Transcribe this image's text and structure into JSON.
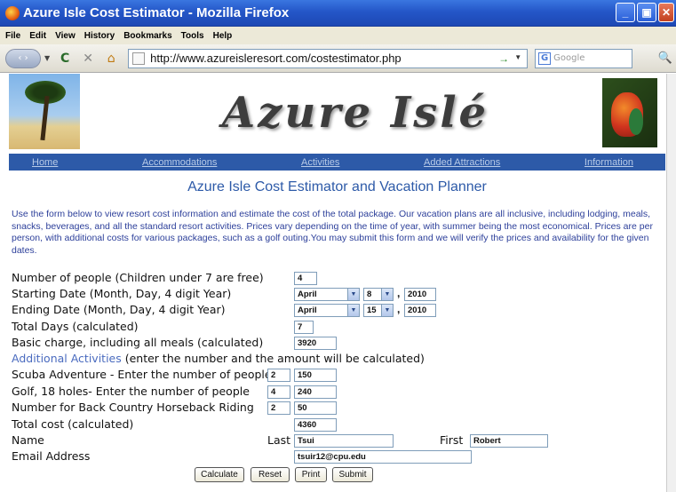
{
  "window": {
    "title": "Azure Isle Cost Estimator - Mozilla Firefox",
    "buttons": [
      "_",
      "▣",
      "✕"
    ]
  },
  "menu": [
    "File",
    "Edit",
    "View",
    "History",
    "Bookmarks",
    "Tools",
    "Help"
  ],
  "toolbar": {
    "url": "http://www.azureisleresort.com/costestimator.php",
    "search_placeholder": "Google",
    "search_engine_label": "G",
    "go_icon": "→",
    "reload_icon": "C",
    "stop_icon": "✕",
    "home_icon": "⌂",
    "back_icons": "‹ ›",
    "dropdown": "▼",
    "search_icon": "🔍"
  },
  "site": {
    "logo_text": "Azure Islé",
    "nav": [
      "Home",
      "Accommodations",
      "Activities",
      "Added Attractions",
      "Information"
    ]
  },
  "form": {
    "title": "Azure Isle Cost Estimator and Vacation Planner",
    "intro": "Use the form below to view resort cost information and estimate the cost of the total package. Our vacation plans are all inclusive, including lodging, meals, snacks, beverages, and all the standard resort activities. Prices vary depending on the time of year, with summer being the most economical. Prices are per person, with additional costs for various packages, such as a golf outing.You may submit this form and we will verify the prices and availability for the given dates.",
    "labels": {
      "people": "Number of people (Children under 7 are free)",
      "start": "Starting Date (Month, Day, 4 digit Year)",
      "end": "Ending Date (Month, Day, 4 digit Year)",
      "days": "Total Days (calculated)",
      "basic": "Basic charge, including all meals (calculated)",
      "additional_link": "Additional Activities",
      "additional_rest": " (enter the number and the amount will be calculated)",
      "scuba": "Scuba Adventure - Enter the number of people",
      "golf": "Golf, 18 holes- Enter the number of people",
      "horse": "Number for Back Country Horseback Riding",
      "total": "Total cost (calculated)",
      "name": "Name",
      "last": "Last",
      "first": "First",
      "email": "Email Address"
    },
    "values": {
      "people": "4",
      "start_month": "April",
      "start_day": "8",
      "start_year": "2010",
      "end_month": "April",
      "end_day": "15",
      "end_year": "2010",
      "days": "7",
      "basic": "3920",
      "scuba_people": "2",
      "scuba_amount": "150",
      "golf_people": "4",
      "golf_amount": "240",
      "horse_people": "2",
      "horse_amount": "50",
      "total": "4360",
      "last": "Tsui",
      "first": "Robert",
      "email": "tsuir12@cpu.edu"
    },
    "comma": ",",
    "select_arrow": "▼",
    "buttons": {
      "calculate": "Calculate",
      "reset": "Reset",
      "print": "Print",
      "submit": "Submit"
    }
  }
}
